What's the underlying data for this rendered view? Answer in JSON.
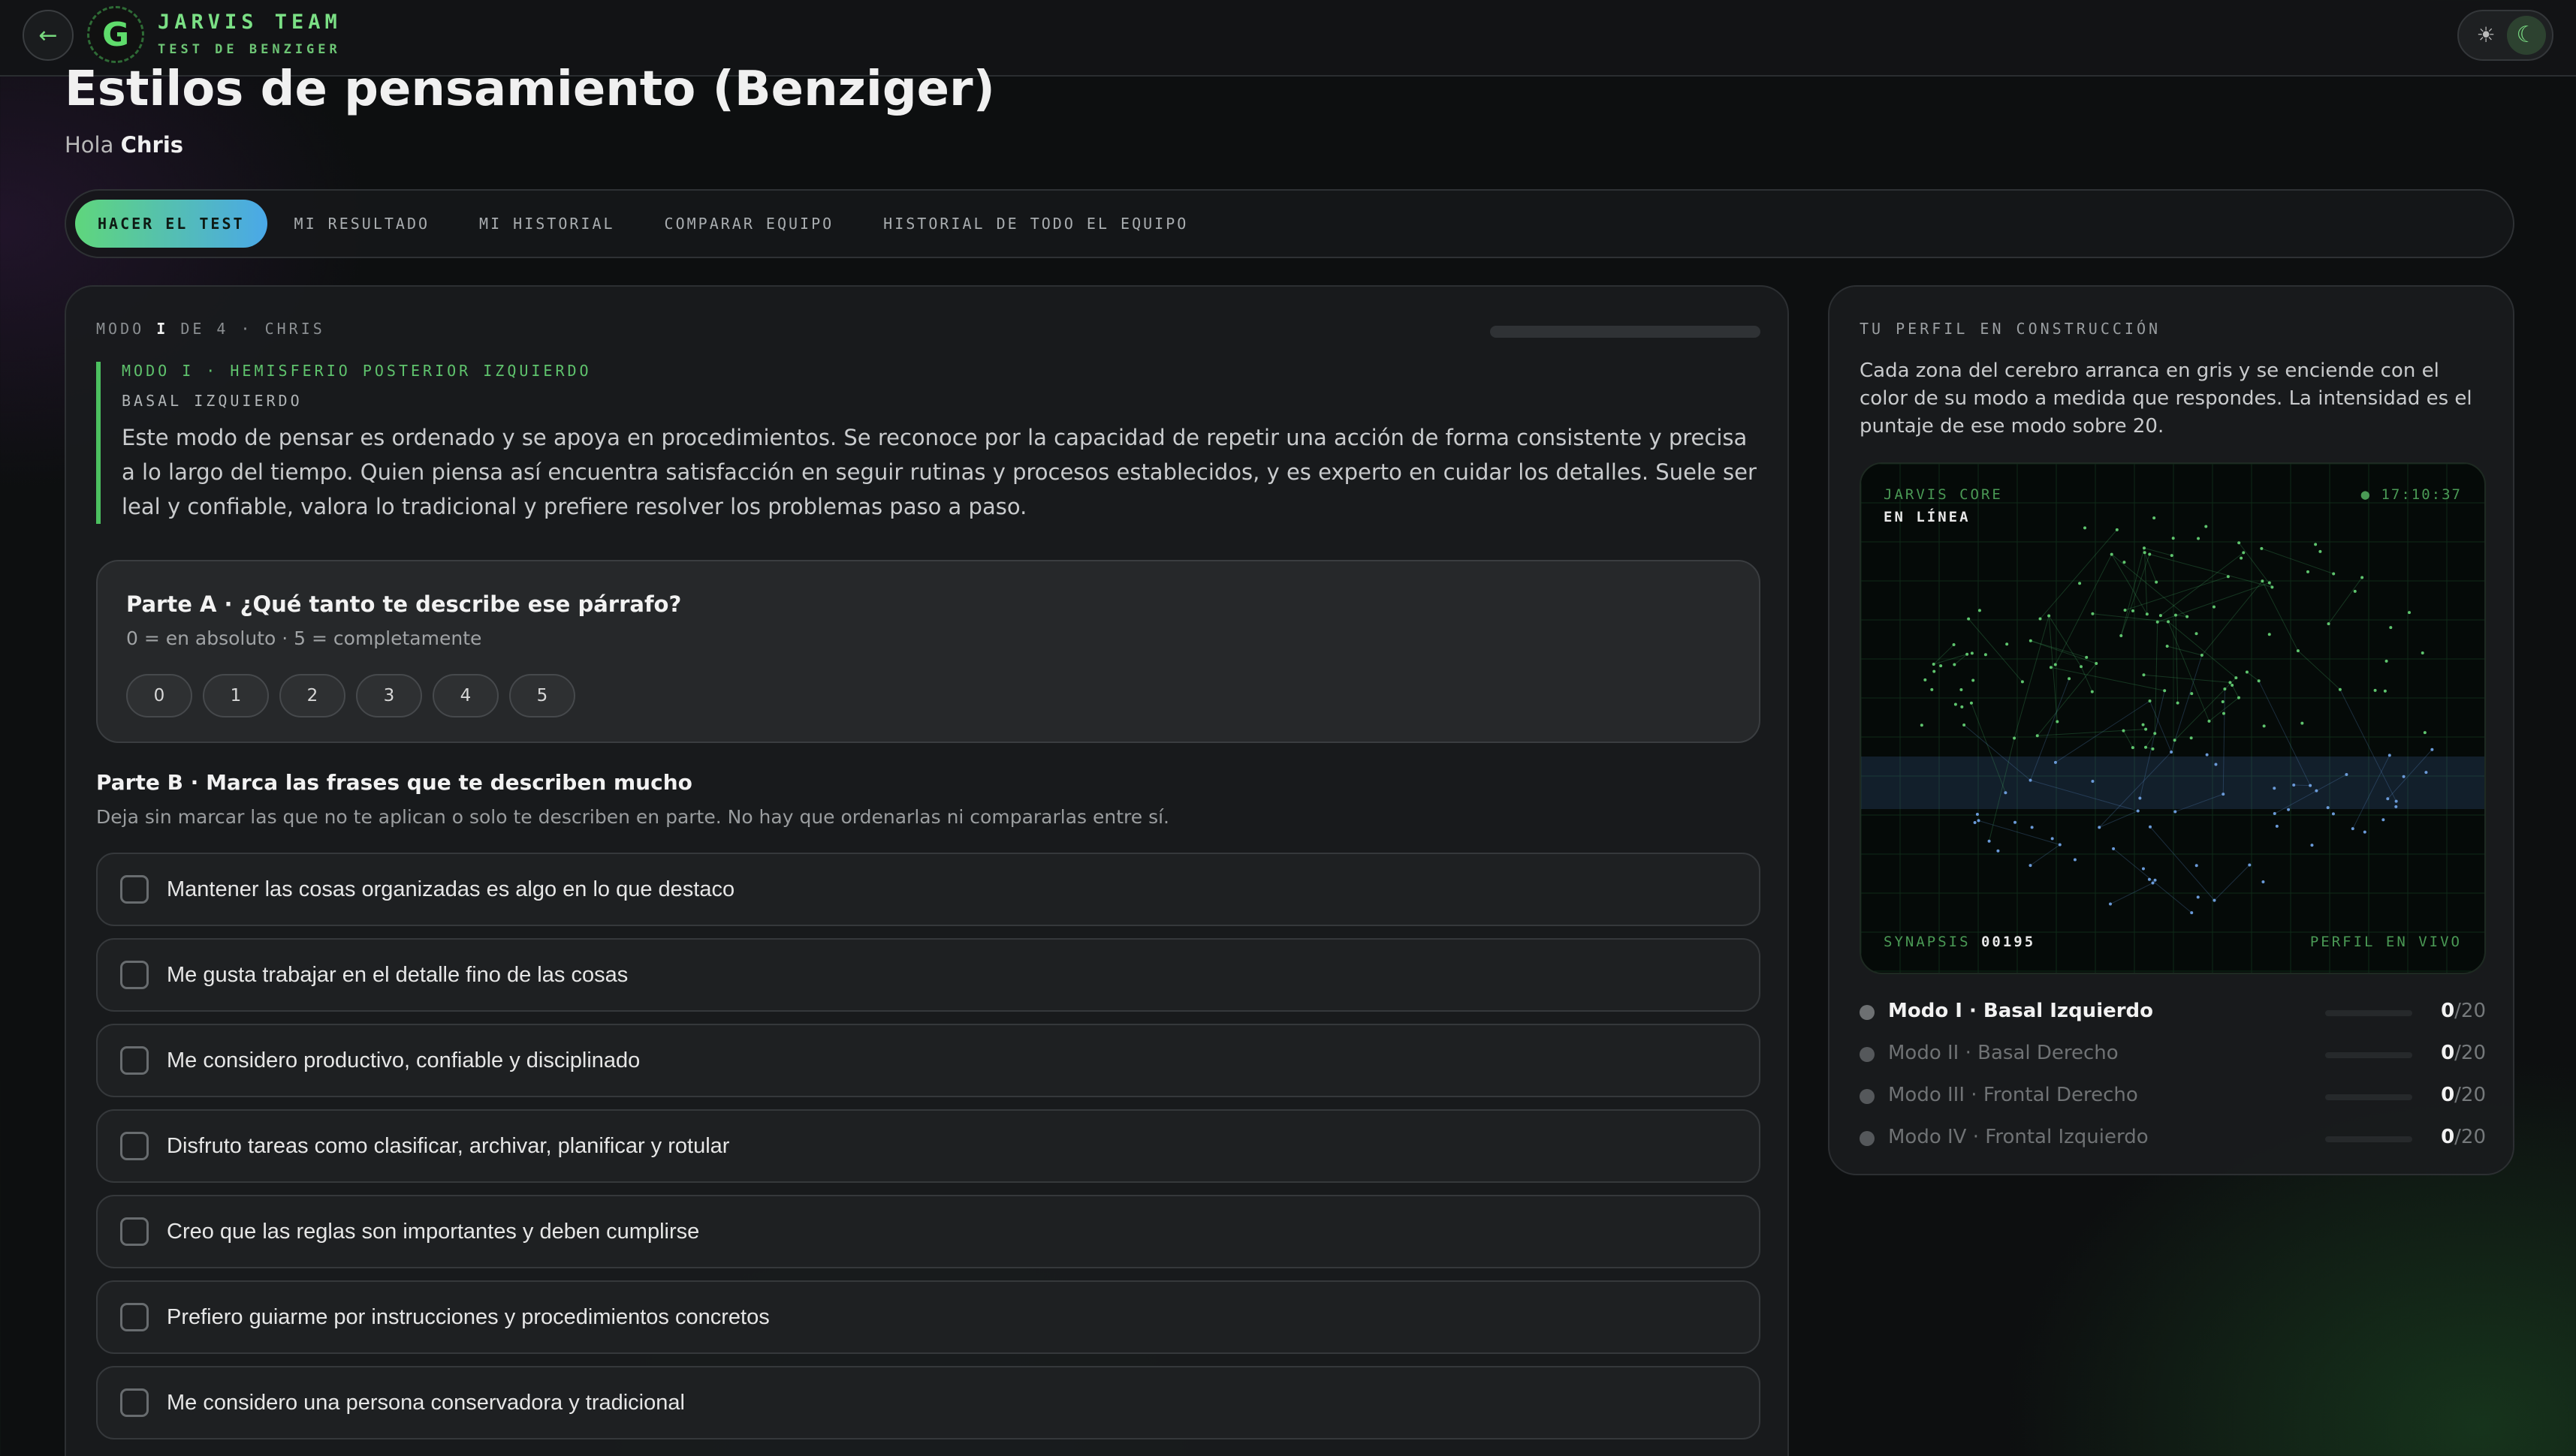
{
  "header": {
    "brand_title": "JARVIS TEAM",
    "brand_subtitle": "TEST DE BENZIGER",
    "logo_letter": "G",
    "back_icon": "arrow-left-icon",
    "theme_icons": [
      "sun-icon",
      "moon-icon"
    ],
    "accent_color": "#5fd67c"
  },
  "page": {
    "title": "Estilos de pensamiento (Benziger)",
    "greeting_prefix": "Hola",
    "user_name": "Chris"
  },
  "tabs": [
    {
      "label": "HACER EL TEST",
      "active": true
    },
    {
      "label": "MI RESULTADO",
      "active": false
    },
    {
      "label": "MI HISTORIAL",
      "active": false
    },
    {
      "label": "COMPARAR EQUIPO",
      "active": false
    },
    {
      "label": "HISTORIAL DE TODO EL EQUIPO",
      "active": false
    }
  ],
  "test": {
    "step_prefix": "MODO",
    "step_current": "I",
    "step_suffix": "DE 4 · CHRIS",
    "progress_fraction": 0,
    "mode_kicker": "MODO I · HEMISFERIO POSTERIOR IZQUIERDO",
    "mode_name": "BASAL IZQUIERDO",
    "mode_paragraph": "Este modo de pensar es ordenado y se apoya en procedimientos. Se reconoce por la capacidad de repetir una acción de forma consistente y precisa a lo largo del tiempo. Quien piensa así encuentra satisfacción en seguir rutinas y procesos establecidos, y es experto en cuidar los detalles. Suele ser leal y confiable, valora lo tradicional y prefiere resolver los problemas paso a paso.",
    "partA": {
      "question": "Parte A · ¿Qué tanto te describe ese párrafo?",
      "scale": "0 = en absoluto · 5 = completamente",
      "options": [
        "0",
        "1",
        "2",
        "3",
        "4",
        "5"
      ]
    },
    "partB": {
      "title": "Parte B · Marca las frases que te describen mucho",
      "subtitle": "Deja sin marcar las que no te aplican o solo te describen en parte. No hay que ordenarlas ni compararlas entre sí.",
      "statements": [
        "Mantener las cosas organizadas es algo en lo que destaco",
        "Me gusta trabajar en el detalle fino de las cosas",
        "Me considero productivo, confiable y disciplinado",
        "Disfruto tareas como clasificar, archivar, planificar y rotular",
        "Creo que las reglas son importantes y deben cumplirse",
        "Prefiero guiarme por instrucciones y procedimientos concretos",
        "Me considero una persona conservadora y tradicional"
      ]
    }
  },
  "profile": {
    "kicker": "TU PERFIL EN CONSTRUCCIÓN",
    "description": "Cada zona del cerebro arranca en gris y se enciende con el color de su modo a medida que respondes. La intensidad es el puntaje de ese modo sobre 20.",
    "viz": {
      "core_label": "JARVIS CORE",
      "status": "EN LÍNEA",
      "clock": "● 17:10:37",
      "synapsis_label": "SYNAPSIS",
      "synapsis_value": "00195",
      "live_label": "PERFIL EN VIVO"
    },
    "modes": [
      {
        "name": "Modo I · Basal Izquierdo",
        "score": "0",
        "max": "/20"
      },
      {
        "name": "Modo II · Basal Derecho",
        "score": "0",
        "max": "/20"
      },
      {
        "name": "Modo III · Frontal Derecho",
        "score": "0",
        "max": "/20"
      },
      {
        "name": "Modo IV · Frontal Izquierdo",
        "score": "0",
        "max": "/20"
      }
    ]
  }
}
